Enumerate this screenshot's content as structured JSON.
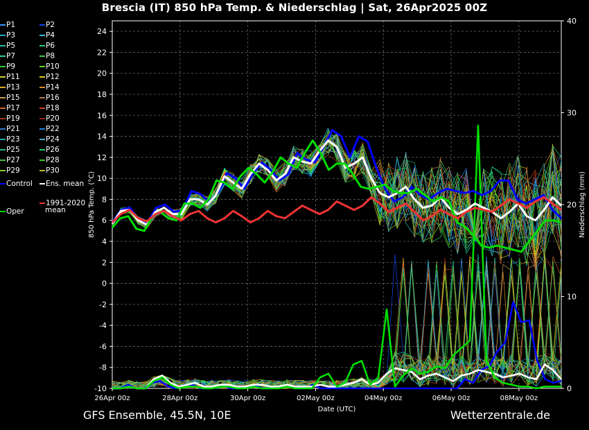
{
  "title": "Brescia  (IT)  850 hPa Temp. & Niederschlag | Sat, 26Apr2025 00Z",
  "footer": {
    "left": "GFS Ensemble, 45.5N, 10E",
    "right": "Wetterzentrale.de"
  },
  "colors": {
    "background": "#000000",
    "control": "#0000ff",
    "ens_mean": "#ffffff",
    "oper": "#00dd00",
    "clim": "#ee3333"
  },
  "legend": {
    "members": [
      "P1",
      "P2",
      "P3",
      "P4",
      "P5",
      "P6",
      "P7",
      "P8",
      "P9",
      "P10",
      "P11",
      "P12",
      "P13",
      "P14",
      "P15",
      "P16",
      "P17",
      "P18",
      "P19",
      "P20",
      "P21",
      "P22",
      "P23",
      "P24",
      "P25",
      "P26",
      "P27",
      "P28",
      "P29",
      "P30"
    ],
    "member_colors": [
      "#3399ff",
      "#1144ee",
      "#22aacc",
      "#33bbdd",
      "#22bbaa",
      "#22cc77",
      "#33cc99",
      "#44cc55",
      "#33cc33",
      "#55dd22",
      "#cccc33",
      "#ddcc22",
      "#ddaa22",
      "#dd8822",
      "#cc9955",
      "#bb7744",
      "#cc6633",
      "#cc4422",
      "#aa3311",
      "#992211",
      "#3377cc",
      "#2288dd",
      "#22aaaa",
      "#44aacc",
      "#22bb88",
      "#22cc66",
      "#44bb44",
      "#33cc22",
      "#88cc22",
      "#bbbb22"
    ],
    "control_label": "Control",
    "mean_label": "Ens. mean",
    "oper_label": "Oper",
    "clim_label_1": "1991-2020",
    "clim_label_2": "mean"
  },
  "chart_data": {
    "type": "line",
    "xlabel": "Date (UTC)",
    "ylabel_left": "850 hPa Temp. (°C)",
    "ylabel_right": "Niederschlag (mm)",
    "x_ticks": [
      "26Apr 00z",
      "28Apr 00z",
      "30Apr 00z",
      "02May 00z",
      "04May 00z",
      "06May 00z",
      "08May 00z"
    ],
    "y_left_ticks": [
      -10,
      -8,
      -6,
      -4,
      -2,
      0,
      2,
      4,
      6,
      8,
      10,
      12,
      14,
      16,
      18,
      20,
      22,
      24
    ],
    "y_right_ticks": [
      0,
      10,
      20,
      30,
      40
    ],
    "ylim_left": [
      -10,
      25
    ],
    "ylim_right": [
      0,
      40
    ],
    "x_days": [
      0,
      13.25
    ],
    "grid": true,
    "temp_series": [
      {
        "name": "Control",
        "values": [
          5.8,
          7.0,
          7.2,
          6.0,
          5.8,
          7.2,
          7.5,
          6.8,
          7.0,
          8.8,
          8.5,
          7.8,
          8.6,
          10.5,
          10.0,
          9.0,
          10.5,
          11.5,
          10.8,
          9.8,
          10.4,
          12.4,
          11.8,
          11.5,
          13.0,
          14.6,
          14.0,
          12.0,
          14.0,
          13.5,
          11.0,
          9.0,
          7.8,
          8.2,
          9.2,
          8.4,
          8.0,
          8.6,
          9.0,
          8.8,
          8.6,
          8.8,
          8.4,
          8.8,
          9.8,
          9.8,
          8.0,
          7.6,
          8.0,
          8.4,
          7.0,
          6.2
        ]
      },
      {
        "name": "Ens. mean",
        "values": [
          5.7,
          6.9,
          7.0,
          6.0,
          5.6,
          6.8,
          7.2,
          6.6,
          6.6,
          8.0,
          8.0,
          7.5,
          8.4,
          10.2,
          9.6,
          9.0,
          10.4,
          11.4,
          10.8,
          9.8,
          10.4,
          12.0,
          11.6,
          11.4,
          12.6,
          13.6,
          13.0,
          11.0,
          11.4,
          12.0,
          10.0,
          8.6,
          8.2,
          8.6,
          9.2,
          8.0,
          7.2,
          7.4,
          8.2,
          7.2,
          6.6,
          7.0,
          7.6,
          7.2,
          6.8,
          6.2,
          6.8,
          7.6,
          6.4,
          6.0,
          7.0,
          8.2,
          7.4
        ]
      },
      {
        "name": "Oper",
        "values": [
          5.3,
          6.2,
          6.4,
          5.2,
          5.0,
          6.4,
          6.8,
          6.2,
          6.0,
          7.6,
          7.6,
          7.2,
          8.0,
          9.8,
          9.6,
          9.0,
          10.2,
          11.0,
          10.4,
          9.6,
          10.6,
          12.0,
          11.4,
          11.0,
          12.4,
          13.6,
          12.4,
          10.8,
          11.4,
          11.4,
          10.4,
          9.2,
          9.0,
          9.2,
          9.4,
          8.8,
          8.6,
          8.6,
          9.0,
          8.4,
          7.8,
          8.2,
          7.8,
          5.8,
          5.4,
          4.6,
          3.6,
          3.4,
          3.6,
          3.4,
          3.2,
          3.0,
          4.0,
          5.0,
          6.0,
          6.0,
          5.8
        ]
      },
      {
        "name": "1991-2020 mean",
        "values": [
          5.8,
          6.6,
          7.0,
          6.2,
          5.9,
          6.6,
          6.9,
          6.4,
          6.0,
          6.6,
          6.9,
          6.2,
          5.8,
          6.2,
          6.9,
          6.4,
          5.8,
          6.2,
          6.9,
          6.4,
          6.2,
          6.8,
          7.4,
          7.0,
          6.6,
          7.0,
          7.8,
          7.4,
          7.0,
          7.4,
          8.2,
          7.6,
          6.8,
          7.2,
          7.6,
          6.8,
          6.0,
          6.4,
          7.0,
          6.6,
          6.2,
          6.8,
          7.2,
          7.0,
          6.8,
          7.4,
          8.0,
          7.6,
          7.2,
          7.8,
          8.2,
          7.6,
          7.0
        ]
      }
    ],
    "precip_series": [
      {
        "name": "Control",
        "values": [
          0,
          0,
          0.4,
          0,
          0,
          0.6,
          0.8,
          0.2,
          0,
          0.4,
          0.4,
          0,
          0,
          0.2,
          0.2,
          0,
          0,
          0.2,
          0.2,
          0,
          0,
          0.2,
          0.2,
          0,
          0,
          0.4,
          0,
          0,
          0,
          0,
          0,
          0,
          0,
          0,
          0,
          0,
          0,
          0,
          0,
          0,
          0,
          0,
          0,
          0,
          1.0,
          0.6,
          2.0,
          2.4,
          4.0,
          5.0,
          9.4,
          7.2,
          7.4,
          3.0,
          1.0,
          0.6,
          0.8
        ]
      },
      {
        "name": "Ens. mean",
        "values": [
          0,
          0,
          0.2,
          0,
          0,
          1.0,
          1.4,
          0.6,
          0.2,
          0.4,
          0.6,
          0.2,
          0.2,
          0.4,
          0.4,
          0.2,
          0.2,
          0.4,
          0.4,
          0.2,
          0.2,
          0.4,
          0.2,
          0.2,
          0.2,
          0.4,
          0.2,
          0.2,
          0.4,
          0.6,
          1.0,
          0.4,
          0.6,
          1.6,
          2.2,
          2.0,
          1.8,
          1.0,
          1.4,
          1.6,
          1.2,
          0.8,
          1.4,
          1.6,
          2.0,
          1.8,
          1.6,
          1.2,
          1.4,
          1.6,
          1.2,
          1.0,
          2.6,
          2.0,
          1.0
        ]
      },
      {
        "name": "Oper",
        "values": [
          0,
          0,
          0.2,
          0,
          0,
          0.8,
          1.2,
          0.4,
          0,
          0.2,
          0.2,
          0,
          0,
          0.2,
          0.2,
          0,
          0,
          0.2,
          0,
          0,
          0,
          0.2,
          0,
          0,
          0,
          1.2,
          1.6,
          0.2,
          0.6,
          2.6,
          3.0,
          0.4,
          1.2,
          8.6,
          0.2,
          1.4,
          2.2,
          1.6,
          1.8,
          2.4,
          2.2,
          3.6,
          4.4,
          5.2,
          28.6,
          3.0,
          1.2,
          0.6,
          0.4,
          0.2,
          0.2,
          0,
          0.2,
          0.2,
          0.2
        ]
      }
    ]
  }
}
